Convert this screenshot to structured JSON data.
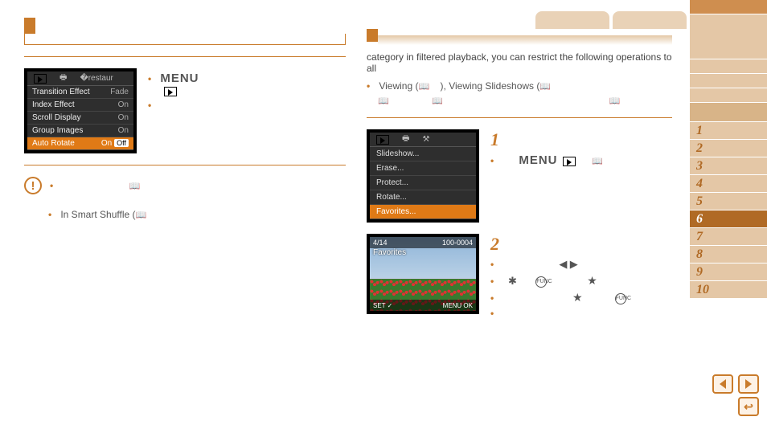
{
  "sidebar": {
    "items": [
      {
        "label": "1"
      },
      {
        "label": "2"
      },
      {
        "label": "3"
      },
      {
        "label": "4"
      },
      {
        "label": "5"
      },
      {
        "label": "6"
      },
      {
        "label": "7"
      },
      {
        "label": "8"
      },
      {
        "label": "9"
      },
      {
        "label": "10"
      }
    ],
    "active_index": 5
  },
  "left": {
    "menu_label": "MENU",
    "cam1": {
      "rows": [
        {
          "k": "Transition Effect",
          "v": "Fade"
        },
        {
          "k": "Index Effect",
          "v": "On"
        },
        {
          "k": "Scroll Display",
          "v": "On"
        },
        {
          "k": "Group Images",
          "v": "On"
        },
        {
          "k": "Auto Rotate",
          "v": "On",
          "off": "Off",
          "hl": true
        }
      ]
    },
    "note_smart": "In Smart Shuffle (",
    "book_glyph": "📖"
  },
  "right": {
    "intro": "category in filtered playback, you can restrict the following operations to all",
    "line1_a": "Viewing (",
    "line1_b": "), Viewing Slideshows (",
    "menu_label": "MENU",
    "cam2": {
      "rows": [
        {
          "t": "Slideshow..."
        },
        {
          "t": "Erase..."
        },
        {
          "t": "Protect..."
        },
        {
          "t": "Rotate..."
        },
        {
          "t": "Favorites...",
          "hl": true
        }
      ]
    },
    "photo": {
      "counter": "4/14",
      "folder": "100-0004",
      "caption": "Favorites",
      "bot_left": "SET ✓",
      "bot_right": "MENU OK"
    },
    "step1": "1",
    "step2": "2"
  }
}
